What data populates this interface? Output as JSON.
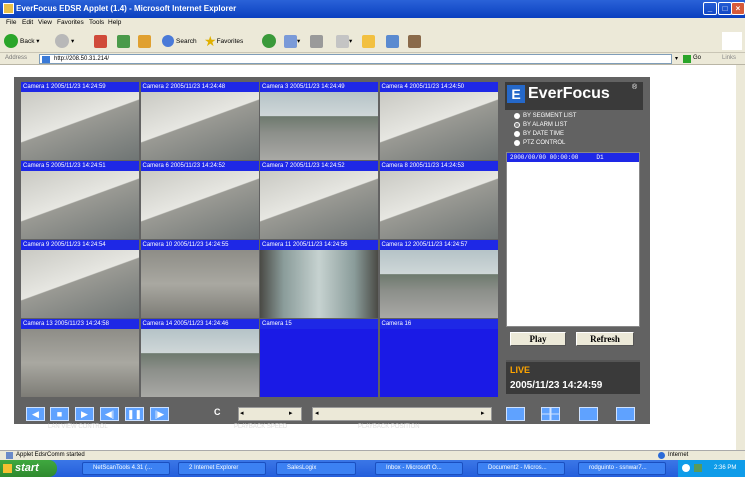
{
  "window": {
    "title": "EverFocus EDSR Applet (1.4) - Microsoft Internet Explorer",
    "controls": [
      "_",
      "□",
      "×"
    ]
  },
  "menu": [
    "File",
    "Edit",
    "View",
    "Favorites",
    "Tools",
    "Help"
  ],
  "toolbar": {
    "back": "Back",
    "search": "Search",
    "favorites": "Favorites"
  },
  "address": {
    "label": "Address",
    "url": "http://208.50.31.214/",
    "go": "Go",
    "links": "Links"
  },
  "cameras": [
    {
      "label": "Camera 1 2005/11/23 14:24:59",
      "scene": "office"
    },
    {
      "label": "Camera 2 2005/11/23 14:24:48",
      "scene": "office"
    },
    {
      "label": "Camera 3 2005/11/23 14:24:49",
      "scene": "parking"
    },
    {
      "label": "Camera 4 2005/11/23 14:24:50",
      "scene": "office"
    },
    {
      "label": "Camera 5 2005/11/23 14:24:51",
      "scene": "office"
    },
    {
      "label": "Camera 6 2005/11/23 14:24:52",
      "scene": "office"
    },
    {
      "label": "Camera 7 2005/11/23 14:24:52",
      "scene": "office"
    },
    {
      "label": "Camera 8 2005/11/23 14:24:53",
      "scene": "office"
    },
    {
      "label": "Camera 9 2005/11/23 14:24:54",
      "scene": "office"
    },
    {
      "label": "Camera 10 2005/11/23 14:24:55",
      "scene": "carpet"
    },
    {
      "label": "Camera 11 2005/11/23 14:24:56",
      "scene": "door"
    },
    {
      "label": "Camera 12 2005/11/23 14:24:57",
      "scene": "parking"
    },
    {
      "label": "Camera 13 2005/11/23 14:24:58",
      "scene": "carpet"
    },
    {
      "label": "Camera 14 2005/11/23 14:24:46",
      "scene": "parking"
    },
    {
      "label": "Camera 15",
      "scene": "none"
    },
    {
      "label": "Camera 16",
      "scene": "none"
    }
  ],
  "brand": "EverFocus",
  "brand_mark": "®",
  "modes": [
    "BY SEGMENT LIST",
    "BY ALARM LIST",
    "BY DATE TIME",
    "PTZ CONTROL"
  ],
  "segment_list": {
    "row": "2000/00/00 00:00:00     D1"
  },
  "buttons": {
    "play": "Play",
    "refresh": "Refresh"
  },
  "live": {
    "label": "LIVE",
    "timestamp": "2005/11/23 14:24:59"
  },
  "controls": {
    "lan_view": "LAN VIEW CONTROL",
    "speed": "PLAYBACK SPEED",
    "position": "PLAYBACK POSITION",
    "speed_value": "C"
  },
  "status": {
    "left": "Applet EdsrComm started",
    "zone": "Internet"
  },
  "taskbar": {
    "start": "start",
    "tasks": [
      "NetScanTools 4.31 (...",
      "2 Internet Explorer",
      "SalesLogix",
      "Inbox - Microsoft O...",
      "Document2 - Micros...",
      "rodguinto - ssnwar7..."
    ],
    "clock": "2:36 PM"
  },
  "colors": {
    "accent": "#1e28e6",
    "applet_bg": "#626262",
    "live": "#ffa500"
  }
}
